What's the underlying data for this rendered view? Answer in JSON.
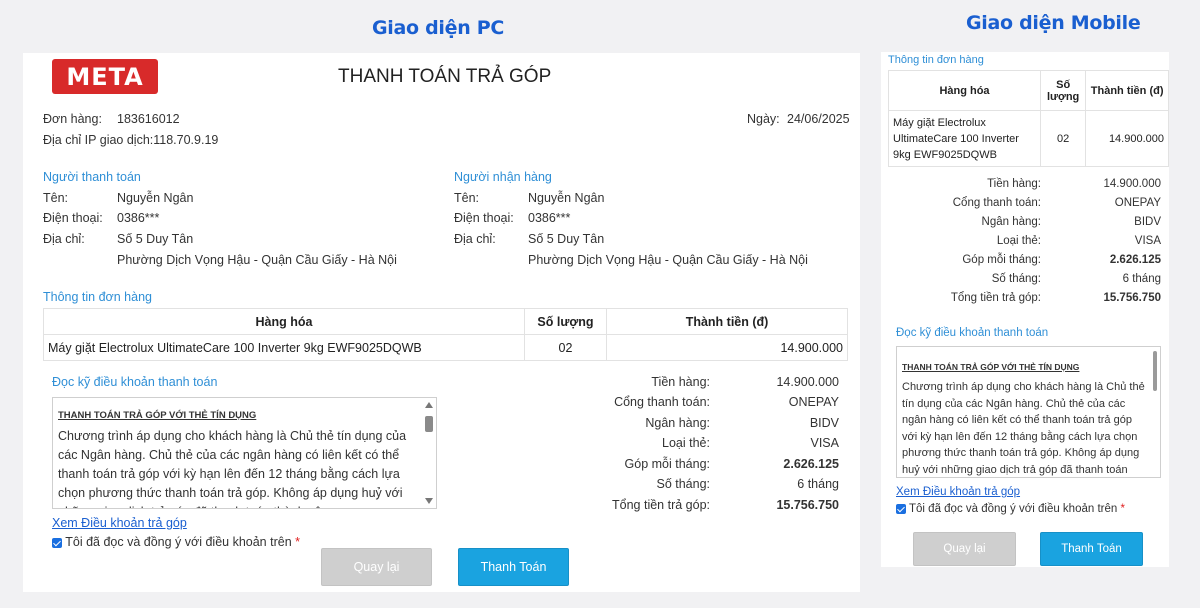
{
  "headings": {
    "pc": "Giao diện PC",
    "mobile": "Giao diện Mobile"
  },
  "pc": {
    "logo": "META",
    "title": "THANH TOÁN TRẢ GÓP",
    "order_label": "Đơn hàng:",
    "order_value": "183616012",
    "ip_text": "Địa chỉ IP giao dịch:118.70.9.19",
    "date_label": "Ngày:",
    "date_value": "24/06/2025",
    "payer": {
      "title": "Người thanh toán",
      "name_label": "Tên:",
      "name": "Nguyễn Ngân",
      "phone_label": "Điện thoại:",
      "phone": "0386***",
      "addr_label": "Địa chỉ:",
      "addr1": "Số 5 Duy Tân",
      "addr2": "Phường Dịch Vọng Hậu - Quận Cầu Giấy - Hà Nội"
    },
    "receiver": {
      "title": "Người nhận hàng",
      "name_label": "Tên:",
      "name": "Nguyễn Ngân",
      "phone_label": "Điện thoại:",
      "phone": "0386***",
      "addr_label": "Địa chỉ:",
      "addr1": "Số 5 Duy Tân",
      "addr2": "Phường Dịch Vọng Hậu - Quận Cầu Giấy - Hà Nội"
    },
    "order_info_title": "Thông tin đơn hàng",
    "table": {
      "headers": [
        "Hàng hóa",
        "Số lượng",
        "Thành tiền (đ)"
      ],
      "row": [
        "Máy giặt Electrolux UltimateCare 100 Inverter 9kg EWF9025DQWB",
        "02",
        "14.900.000"
      ]
    },
    "terms_title": "Đọc kỹ điều khoản thanh toán",
    "terms_heading": "THANH TOÁN TRẢ GÓP VỚI THẺ TÍN DỤNG",
    "terms_body": "Chương trình áp dụng cho khách hàng là Chủ thẻ tín dụng của các Ngân hàng. Chủ thẻ của các ngân hàng có liên kết có thể thanh toán trả góp với kỳ hạn lên đến 12 tháng bằng cách lựa chọn phương thức thanh toán trả góp. Không áp dụng huỷ với những giao dịch trả góp đã thanh toán thành công.",
    "terms_link": "Xem Điều khoản trả góp",
    "agree_text": "Tôi đã đọc và đồng ý với điều khoản trên",
    "required_mark": "*",
    "summary": [
      {
        "label": "Tiền hàng:",
        "value": "14.900.000",
        "bold": false
      },
      {
        "label": "Cổng thanh toán:",
        "value": "ONEPAY",
        "bold": false
      },
      {
        "label": "Ngân hàng:",
        "value": "BIDV",
        "bold": false
      },
      {
        "label": "Loại thẻ:",
        "value": "VISA",
        "bold": false
      },
      {
        "label": "Góp mỗi tháng:",
        "value": "2.626.125",
        "bold": true
      },
      {
        "label": "Số tháng:",
        "value": "6 tháng",
        "bold": false
      },
      {
        "label": "Tổng tiền trả góp:",
        "value": "15.756.750",
        "bold": true
      }
    ],
    "back_label": "Quay lại",
    "pay_label": "Thanh Toán"
  },
  "mobile": {
    "order_info_title": "Thông tin đơn hàng",
    "table": {
      "headers": [
        "Hàng hóa",
        "Số lượng",
        "Thành tiền (đ)"
      ],
      "row": [
        "Máy giặt Electrolux UltimateCare 100 Inverter 9kg EWF9025DQWB",
        "02",
        "14.900.000"
      ]
    },
    "summary": [
      {
        "label": "Tiền hàng:",
        "value": "14.900.000",
        "bold": false
      },
      {
        "label": "Cổng thanh toán:",
        "value": "ONEPAY",
        "bold": false
      },
      {
        "label": "Ngân hàng:",
        "value": "BIDV",
        "bold": false
      },
      {
        "label": "Loại thẻ:",
        "value": "VISA",
        "bold": false
      },
      {
        "label": "Góp mỗi tháng:",
        "value": "2.626.125",
        "bold": true
      },
      {
        "label": "Số tháng:",
        "value": "6 tháng",
        "bold": false
      },
      {
        "label": "Tổng tiền trả góp:",
        "value": "15.756.750",
        "bold": true
      }
    ],
    "terms_title": "Đọc kỹ điều khoản thanh toán",
    "terms_heading": "THANH TOÁN TRẢ GÓP VỚI THẺ TÍN DỤNG",
    "terms_body": "Chương trình áp dụng cho khách hàng là Chủ thẻ tín dụng của các Ngân hàng. Chủ thẻ của các ngân hàng có liên kết có thể thanh toán trả góp với kỳ hạn lên đến 12 tháng bằng cách lựa chọn phương thức thanh toán trả góp. Không áp dụng huỷ với những giao dịch trả góp đã thanh toán thành công.",
    "terms_link": "Xem Điều khoản trả góp",
    "agree_text": "Tôi đã đọc và đồng ý với điều khoản trên",
    "required_mark": "*",
    "back_label": "Quay lại",
    "pay_label": "Thanh Toán"
  }
}
